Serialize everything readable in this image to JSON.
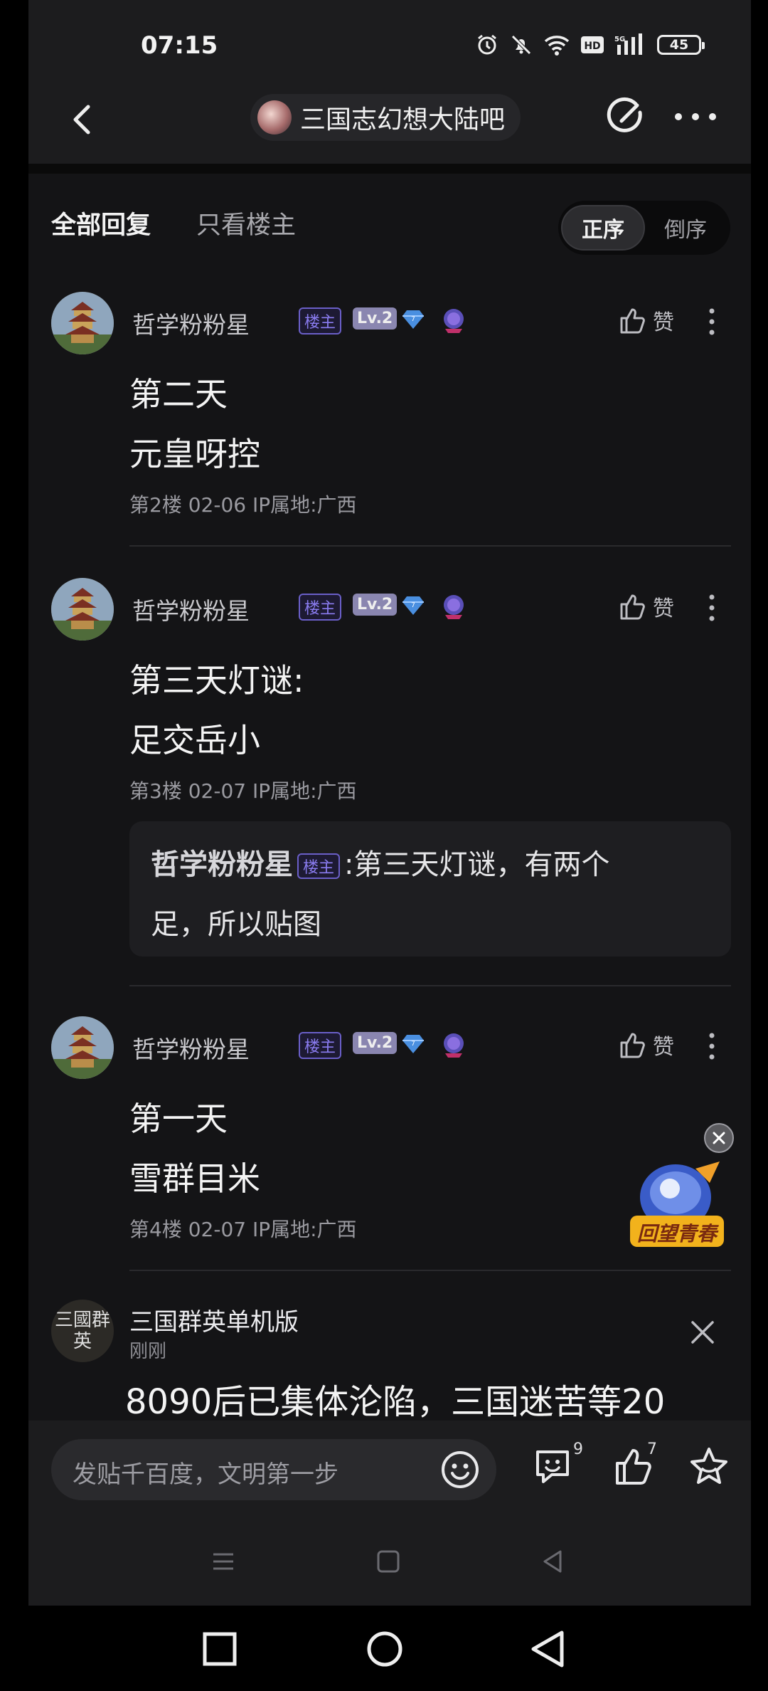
{
  "status": {
    "time": "07:15",
    "battery": "45"
  },
  "header": {
    "forum_name": "三国志幻想大陆吧"
  },
  "tabs": {
    "all": "全部回复",
    "owner_only": "只看楼主",
    "order_asc": "正序",
    "order_desc": "倒序"
  },
  "posts": [
    {
      "username": "哲学粉粉星",
      "owner_badge": "楼主",
      "level": "Lv.2",
      "like_label": "赞",
      "lines": [
        "第二天",
        "元皇呀控"
      ],
      "meta": "第2楼  02-06  IP属地:广西"
    },
    {
      "username": "哲学粉粉星",
      "owner_badge": "楼主",
      "level": "Lv.2",
      "like_label": "赞",
      "lines": [
        "第三天灯谜:",
        "足交岳小"
      ],
      "meta": "第3楼  02-07  IP属地:广西",
      "reply": {
        "name": "哲学粉粉星",
        "badge": "楼主",
        "colon": ":",
        "text1": "第三天灯谜，有两个",
        "text2": "足，所以贴图"
      }
    },
    {
      "username": "哲学粉粉星",
      "owner_badge": "楼主",
      "level": "Lv.2",
      "like_label": "赞",
      "lines": [
        "第一天",
        "雪群目米"
      ],
      "meta": "第4楼  02-07  IP属地:广西"
    }
  ],
  "promo": {
    "label": "回望青春"
  },
  "ad": {
    "avatar_text": "三國群英",
    "name": "三国群英单机版",
    "time": "刚刚",
    "text": "8090后已集体沦陷，三国迷苦等20"
  },
  "bottom": {
    "placeholder": "发贴千百度，文明第一步",
    "comment_count": "9",
    "like_count": "7"
  }
}
